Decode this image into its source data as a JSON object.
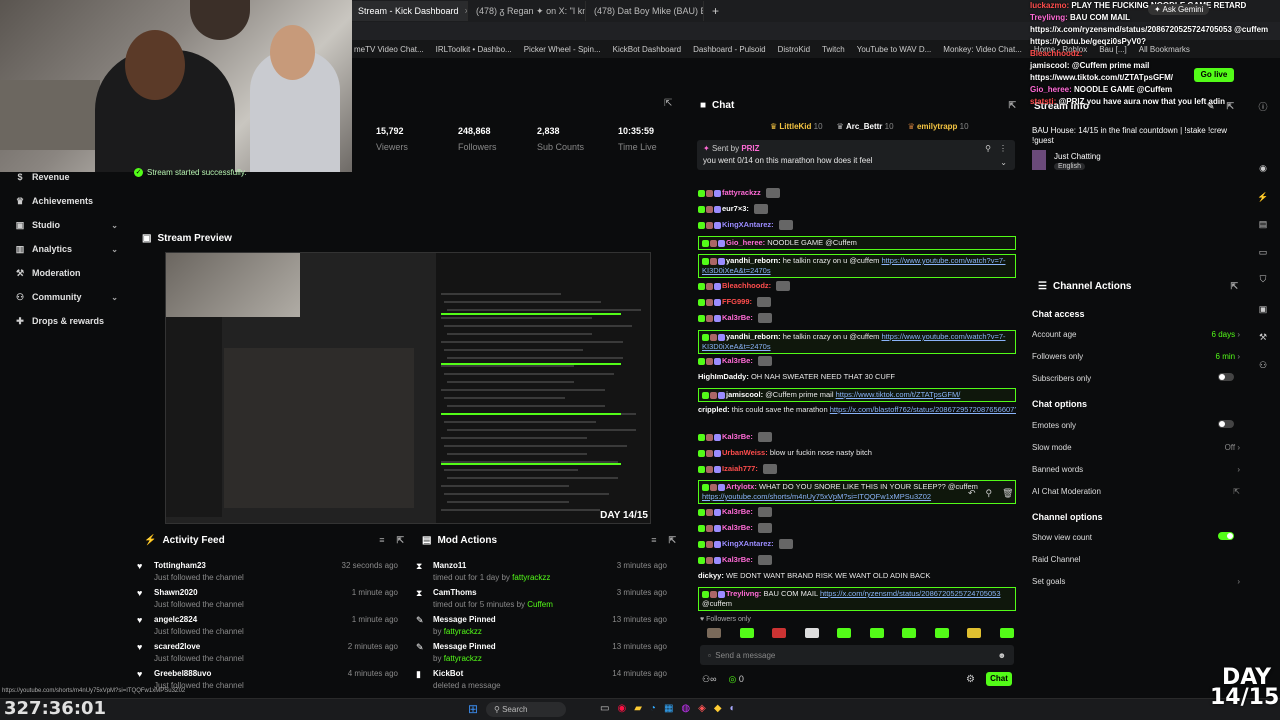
{
  "browser": {
    "tabs": [
      {
        "label": "Stream - Kick Dashboard",
        "active": true
      },
      {
        "label": "(478) ᵹ Regan ✦ on X: \"I know",
        "active": false
      },
      {
        "label": "(478) Dat Boy Mike (BAU) BAN",
        "active": false
      }
    ],
    "bookmarks": [
      "meTV Video Chat...",
      "IRLToolkit • Dashbo...",
      "Picker Wheel - Spin...",
      "KickBot Dashboard",
      "Dashboard - Pulsoid",
      "DistroKid",
      "Twitch",
      "YouTube to WAV D...",
      "Monkey: Video Chat...",
      "Home - Roblox",
      "Bau [...]",
      "All Bookmarks"
    ],
    "ask_gemini": "Ask Gemini"
  },
  "sidebar": {
    "items": [
      {
        "label": "Revenue",
        "icon": "dollar-icon"
      },
      {
        "label": "Achievements",
        "icon": "trophy-icon"
      },
      {
        "label": "Studio",
        "icon": "studio-icon",
        "chevron": true
      },
      {
        "label": "Analytics",
        "icon": "chart-icon",
        "chevron": true
      },
      {
        "label": "Moderation",
        "icon": "gavel-icon"
      },
      {
        "label": "Community",
        "icon": "community-icon",
        "chevron": true
      },
      {
        "label": "Drops & rewards",
        "icon": "gift-icon"
      }
    ]
  },
  "stats": [
    {
      "value": "15,792",
      "label": "Viewers"
    },
    {
      "value": "248,868",
      "label": "Followers"
    },
    {
      "value": "2,838",
      "label": "Sub Counts"
    },
    {
      "value": "10:35:59",
      "label": "Time Live"
    }
  ],
  "toast": "Stream started successfully.",
  "preview": {
    "title": "Stream Preview",
    "overlay": "DAY 14/15"
  },
  "activity": {
    "title": "Activity Feed",
    "rows": [
      {
        "name": "Tottingham23",
        "desc": "Just followed the channel",
        "time": "32 seconds ago"
      },
      {
        "name": "Shawn2020",
        "desc": "Just followed the channel",
        "time": "1 minute ago"
      },
      {
        "name": "angelc2824",
        "desc": "Just followed the channel",
        "time": "1 minute ago"
      },
      {
        "name": "scared2love",
        "desc": "Just followed the channel",
        "time": "2 minutes ago"
      },
      {
        "name": "Greebel888uvo",
        "desc": "Just followed the channel",
        "time": "4 minutes ago"
      }
    ]
  },
  "mod_actions": {
    "title": "Mod Actions",
    "rows": [
      {
        "name": "Manzo11",
        "desc": "timed out for 1 day by",
        "by": "fattyrackzz",
        "time": "3 minutes ago",
        "icon": "hourglass-icon"
      },
      {
        "name": "CamThoms",
        "desc": "timed out for 5 minutes by",
        "by": "Cuffem",
        "time": "3 minutes ago",
        "icon": "hourglass-icon"
      },
      {
        "name": "Message Pinned",
        "desc": "by",
        "by": "fattyrackzz",
        "time": "13 minutes ago",
        "icon": "pin-icon"
      },
      {
        "name": "Message Pinned",
        "desc": "by",
        "by": "fattyrackzz",
        "time": "13 minutes ago",
        "icon": "pin-icon"
      },
      {
        "name": "KickBot",
        "desc": "deleted a message",
        "by": "",
        "time": "14 minutes ago",
        "icon": "trash-icon"
      }
    ]
  },
  "chat": {
    "title": "Chat",
    "top_gifters": [
      {
        "name": "LittleKid",
        "count": "10"
      },
      {
        "name": "Arc_Bettr",
        "count": "10"
      },
      {
        "name": "emilytrapp",
        "count": "10"
      }
    ],
    "pinned_by": "Sent by",
    "pinned_user": "PRIZ",
    "pinned_text": "you went 0/14 on this marathon how does it feel",
    "messages": [
      {
        "user": "fattyrackzz",
        "color": "#ff6bd6",
        "text": "",
        "hl": false
      },
      {
        "user": "eur7×3:",
        "color": "#ffffff",
        "text": "",
        "hl": false
      },
      {
        "user": "KingXAntarez:",
        "color": "#9b8cff",
        "text": "",
        "hl": false
      },
      {
        "user": "Gio_heree:",
        "color": "#ff6bd6",
        "text": "NOODLE GAME @Cuffem",
        "hl": true
      },
      {
        "user": "yandhi_reborn:",
        "color": "#ffffff",
        "text": "he talkin crazy on u @cuffem",
        "link": "https://www.youtube.com/watch?v=7-KI3D0iXeA&t=2470s",
        "hl": true
      },
      {
        "user": "Bleachhoodz:",
        "color": "#ff4d4d",
        "text": "",
        "hl": false
      },
      {
        "user": "FFG999:",
        "color": "#ff4d4d",
        "text": "",
        "hl": false
      },
      {
        "user": "Kal3rBe:",
        "color": "#ff6bd6",
        "text": "",
        "hl": false
      },
      {
        "user": "yandhi_reborn:",
        "color": "#ffffff",
        "text": "he talkin crazy on u @cuffem",
        "link": "https://www.youtube.com/watch?v=7-KI3D0iXeA&t=2470s",
        "hl": true
      },
      {
        "user": "Kal3rBe:",
        "color": "#ff6bd6",
        "text": "",
        "hl": false
      },
      {
        "user": "HighImDaddy:",
        "color": "#ffffff",
        "text": "OH NAH SWEATER NEED THAT 30 CUFF",
        "hl": false
      },
      {
        "user": "jamiscool:",
        "color": "#ffffff",
        "text": "@Cuffem prime mail",
        "link": "https://www.tiktok.com/t/ZTATpsGFM/",
        "hl": true
      },
      {
        "user": "crippled:",
        "color": "#ffffff",
        "text": "this could save the marathon",
        "link": "https://x.com/blastoff762/status/2086729572087656607?s=20",
        "hl": false
      },
      {
        "user": "Kal3rBe:",
        "color": "#ff6bd6",
        "text": "",
        "hl": false
      },
      {
        "user": "UrbanWeiss:",
        "color": "#ff4d4d",
        "text": "blow ur fuckin nose nasty bitch",
        "hl": false
      },
      {
        "user": "Izaiah777:",
        "color": "#ff4d4d",
        "text": "",
        "hl": false
      },
      {
        "user": "Artylotx:",
        "color": "#ff6bd6",
        "text": "WHAT DO YOU SNORE LIKE THIS IN YOUR SLEEP?? @cuffem",
        "link": "https://youtube.com/shorts/m4nUy75xVpM?si=ITQQFw1xMPSu3Z02",
        "hl": true
      },
      {
        "user": "Kal3rBe:",
        "color": "#ff6bd6",
        "text": "",
        "hl": false
      },
      {
        "user": "Kal3rBe:",
        "color": "#ff6bd6",
        "text": "",
        "hl": false
      },
      {
        "user": "KingXAntarez:",
        "color": "#9b8cff",
        "text": "",
        "hl": false
      },
      {
        "user": "Kal3rBe:",
        "color": "#ff6bd6",
        "text": "",
        "hl": false
      },
      {
        "user": "dickyy:",
        "color": "#ffffff",
        "text": "WE DONT WANT BRAND RISK WE WANT OLD ADIN BACK",
        "hl": false
      },
      {
        "user": "Treylivng:",
        "color": "#ff6bd6",
        "text": "BAU COM MAIL",
        "link": "https://x.com/ryzensmd/status/2086720525724705053",
        "tail": "@cuffem",
        "hl": true
      }
    ],
    "followers_only": "Followers only",
    "input_placeholder": "Send a message",
    "count": "0",
    "send_label": "Chat"
  },
  "stream_info": {
    "title": "Stream Info",
    "text": "BAU House: 14/15 in the final countdown | !stake !crew !guest",
    "category": "Just Chatting",
    "language": "English"
  },
  "channel_actions": {
    "title": "Channel Actions",
    "chat_access": "Chat access",
    "account_age": {
      "label": "Account age",
      "value": "6 days"
    },
    "followers_only": {
      "label": "Followers only",
      "value": "6 min"
    },
    "subscribers_only": {
      "label": "Subscribers only",
      "on": false
    },
    "chat_options": "Chat options",
    "emotes_only": {
      "label": "Emotes only",
      "on": false
    },
    "slow_mode": {
      "label": "Slow mode",
      "value": "Off"
    },
    "banned_words": "Banned words",
    "ai_moderation": "AI Chat Moderation",
    "channel_options": "Channel options",
    "show_view_count": {
      "label": "Show view count",
      "on": true
    },
    "raid_channel": "Raid Channel",
    "set_goals": "Set goals"
  },
  "overlay_chat": [
    {
      "user": "luckazmo:",
      "text": "PLAY THE FUCKING NOODLE GAME RETARD",
      "color": "#ff4d4d"
    },
    {
      "user": "Treylivng:",
      "text": "BAU COM MAIL",
      "color": "#ff6bd6"
    },
    {
      "user": "",
      "text": "https://x.com/ryzensmd/status/2086720525724705053 @cuffem",
      "color": "#ffffff"
    },
    {
      "user": "",
      "text": "https://youtu.be/geqzi0sPyV0?",
      "color": "#ffffff"
    },
    {
      "user": "Bleachhoodz:",
      "text": "",
      "color": "#ff4d4d"
    },
    {
      "user": "jamiscool:",
      "text": "@Cuffem prime mail",
      "color": "#ffffff"
    },
    {
      "user": "",
      "text": "https://www.tiktok.com/t/ZTATpsGFM/",
      "color": "#ffffff"
    },
    {
      "user": "Gio_heree:",
      "text": "NOODLE GAME @Cuffem",
      "color": "#ff6bd6"
    },
    {
      "user": "statsti:",
      "text": "@PRIZ you have aura now that you left adin",
      "color": "#ff4d4d"
    }
  ],
  "go_live": "Go live",
  "taskbar": {
    "search": "Search"
  },
  "clock": "327:36:01",
  "status_url": "https://youtube.com/shorts/m4nUy75xVpM?si=ITQQFw1xMPSu3Z02",
  "day_overlay": {
    "line1": "DAY",
    "line2": "14/15"
  }
}
